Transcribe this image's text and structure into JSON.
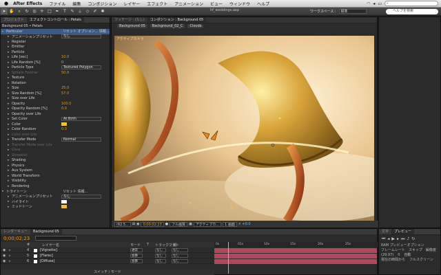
{
  "menubar": {
    "apple": "",
    "app_name": "After Effects",
    "items": [
      "ファイル",
      "編集",
      "コンポジション",
      "レイヤー",
      "エフェクト",
      "アニメーション",
      "ビュー",
      "ウィンドウ",
      "ヘルプ"
    ]
  },
  "toolbar": {
    "project_title": "hf_weddings.aep",
    "workspace_label": "ワークスペース :",
    "workspace_value": "標準",
    "help_placeholder": "ヘルプを検索"
  },
  "left_panel": {
    "tabs": [
      "プロジェクト",
      "エフェクトコントロール : Petals"
    ],
    "header": "Background 05 • Petals",
    "rows": [
      {
        "lbl": "Particular",
        "val": "リセット  オプション...  情報...",
        "type": "fx"
      },
      {
        "lbl": "アニメーションプリセット",
        "dd": "なし"
      },
      {
        "lbl": "Register"
      },
      {
        "lbl": "Emitter"
      },
      {
        "lbl": "Particle"
      },
      {
        "lbl": "Life [sec]",
        "val": "10.0"
      },
      {
        "lbl": "Life Random [%]",
        "val": "0"
      },
      {
        "lbl": "Particle Type",
        "dd": "Textured Polygon"
      },
      {
        "lbl": "Sphere Feather",
        "val": "50.0",
        "dim": true
      },
      {
        "lbl": "Texture"
      },
      {
        "lbl": "Rotation"
      },
      {
        "lbl": "Size",
        "val": "25.0"
      },
      {
        "lbl": "Size Random [%]",
        "val": "57.0"
      },
      {
        "lbl": "Size over Life"
      },
      {
        "lbl": "Opacity",
        "val": "100.0"
      },
      {
        "lbl": "Opacity Random [%]",
        "val": "0.0"
      },
      {
        "lbl": "Opacity over Life"
      },
      {
        "lbl": "Set Color",
        "dd": "At Birth"
      },
      {
        "lbl": "Color",
        "swatch": "#f0c23c"
      },
      {
        "lbl": "Color Random",
        "val": "0.0"
      },
      {
        "lbl": "Color over Life",
        "dim": true
      },
      {
        "lbl": "Transfer Mode",
        "dd": "Normal"
      },
      {
        "lbl": "Transfer Mode over Life",
        "dim": true
      },
      {
        "lbl": "Glow",
        "dim": true
      },
      {
        "lbl": "Streaklet",
        "dim": true
      },
      {
        "lbl": "Shading"
      },
      {
        "lbl": "Physics"
      },
      {
        "lbl": "Aux System"
      },
      {
        "lbl": "World Transform"
      },
      {
        "lbl": "Visibility"
      },
      {
        "lbl": "Rendering"
      },
      {
        "lbl": "トライトーン",
        "val": "リセット  情報...",
        "type": "fx"
      },
      {
        "lbl": "アニメーションプリセット",
        "dd": "なし"
      },
      {
        "lbl": "ハイライト",
        "swatch": "#ffffff"
      },
      {
        "lbl": "ミッドトーン",
        "swatch": "#f0c23c"
      }
    ]
  },
  "viewer": {
    "tabs": [
      "フッテージ : (なし)",
      "コンポジション : Background 05"
    ],
    "crumbs": [
      "Background 05",
      "Background_02_C",
      "Clouds"
    ],
    "camera_label": "アクティブカメラ",
    "controls": {
      "zoom": "(62.5...",
      "timecode": "0;00;02;23",
      "resolution": "フル画質",
      "camera": "アクティブカ...",
      "views": "1 画面",
      "exposure": "+0.0"
    }
  },
  "timeline": {
    "tabs": [
      "レンダーキュー",
      "Background 05"
    ],
    "timecode": "0;00;02;23",
    "cols": [
      "#",
      "レイヤー名",
      "モード",
      "T",
      "トラックマット",
      "親"
    ],
    "ruler": [
      "0s",
      "01s",
      "10s",
      "15s",
      "20s",
      "25s"
    ],
    "layers": [
      {
        "num": "4",
        "name": "[Vignette]",
        "mode": "通常",
        "matte": "なし",
        "parent": "なし"
      },
      {
        "num": "5",
        "name": "[Flares]",
        "mode": "加算",
        "matte": "なし",
        "parent": "なし"
      },
      {
        "num": "6",
        "name": "[Diffuse]",
        "mode": "加算",
        "matte": "なし",
        "parent": "なし"
      }
    ],
    "switch_label": "スイッチ / モード"
  },
  "preview": {
    "tabs": [
      "文字",
      "プレビュー"
    ],
    "ram_label": "RAM プレビューオプション",
    "fps_label": "フレームレート",
    "skip_label": "スキップ",
    "res_label": "解像度",
    "fps_value": "(29.97)",
    "skip_value": "0",
    "res_value": "自動",
    "from_label": "現在の時間から",
    "fullscreen_label": "フルスクリーン"
  },
  "colors": {
    "accent": "#e49a2b",
    "layer_bar": "#b0465c",
    "gold": "#d9a43a",
    "selection": "#3c5a86"
  }
}
